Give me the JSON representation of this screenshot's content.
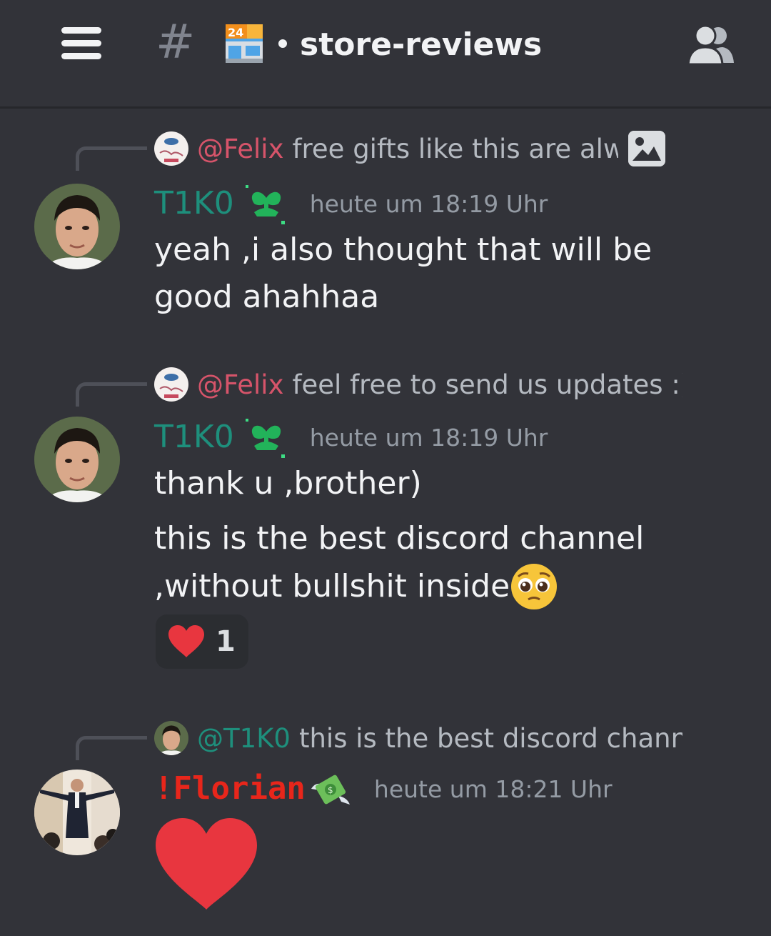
{
  "header": {
    "hash_symbol": "#",
    "store_badge": "24",
    "channel_name": "store-reviews"
  },
  "messages": [
    {
      "reply": {
        "mention": "@Felix",
        "text": "free gifts like this are alwa",
        "mention_color": "#d6546a"
      },
      "author": "T1K0",
      "author_color": "#1e8f7c",
      "timestamp": "heute um 18:19 Uhr",
      "lines": [
        "yeah ,i also thought that will be",
        "good ahahhaa"
      ]
    },
    {
      "reply": {
        "mention": "@Felix",
        "text": "feel free to send us updates :)",
        "mention_color": "#d6546a"
      },
      "author": "T1K0",
      "author_color": "#1e8f7c",
      "timestamp": "heute um 18:19 Uhr",
      "lines": [
        "thank u ,brother)",
        "this is the best discord channel",
        ",without bullshit inside"
      ],
      "reaction": {
        "emoji": "heart",
        "count": "1"
      }
    },
    {
      "reply": {
        "mention": "@T1K0",
        "text": "this is the best discord chann",
        "mention_color": "#1e8f7c"
      },
      "author": "!Florian",
      "author_color": "#e8261b",
      "timestamp": "heute um 18:21 Uhr",
      "big_emoji": "heart"
    }
  ],
  "icons": {
    "menu": "hamburger-icon",
    "channel": "hash-icon",
    "store": "convenience-store-icon",
    "members": "members-icon",
    "badge": "sprout-icon",
    "money": "money-with-wings-icon",
    "image": "image-icon",
    "pleading": "pleading-face-icon"
  },
  "colors": {
    "background": "#323339",
    "heart": "#e8363f",
    "timestamp": "#949ba4"
  }
}
